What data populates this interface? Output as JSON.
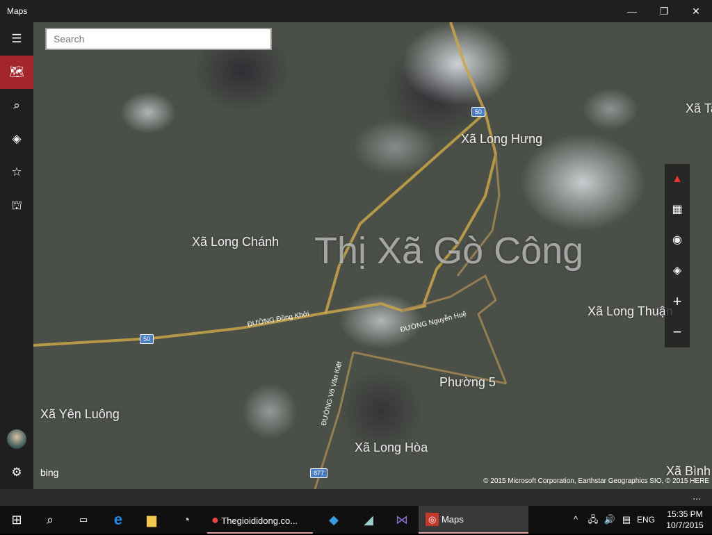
{
  "window": {
    "title": "Maps",
    "minimize": "—",
    "maximize": "❐",
    "close": "✕"
  },
  "sidebar": {
    "items": [
      {
        "name": "menu",
        "icon": "☰"
      },
      {
        "name": "map",
        "icon": "🗺"
      },
      {
        "name": "search",
        "icon": "⌕"
      },
      {
        "name": "directions",
        "icon": "◈"
      },
      {
        "name": "favorites",
        "icon": "☆"
      },
      {
        "name": "3d-cities",
        "icon": "⛫"
      }
    ],
    "settings": "⚙"
  },
  "search": {
    "placeholder": "Search"
  },
  "map": {
    "labels": [
      "Xã Long Hưng",
      "Xã Long Chánh",
      "Thị Xã Gò Công",
      "Xã Long Thuận",
      "Phường 5",
      "Xã Yên Luông",
      "Xã Long Hòa",
      "Xã Bình Ng",
      "Xã Ta"
    ],
    "roads": [
      "ĐƯỜNG Đồng Khởi",
      "ĐƯỜNG Nguyễn Huệ",
      "ĐƯỜNG Võ Văn Kiệt"
    ],
    "shields": [
      "50",
      "50",
      "877"
    ],
    "copyright": "© 2015 Microsoft Corporation, Earthstar Geographics  SIO, © 2015 HERE",
    "logo": "bing"
  },
  "controls": [
    "compass",
    "tilt",
    "locate",
    "layers",
    "zoom-in",
    "zoom-out"
  ],
  "appbar": {
    "more": "..."
  },
  "taskbar": {
    "chrome_label": "Thegioididong.co...",
    "maps_label": "Maps",
    "lang": "ENG",
    "time": "15:35 PM",
    "date": "10/7/2015"
  }
}
